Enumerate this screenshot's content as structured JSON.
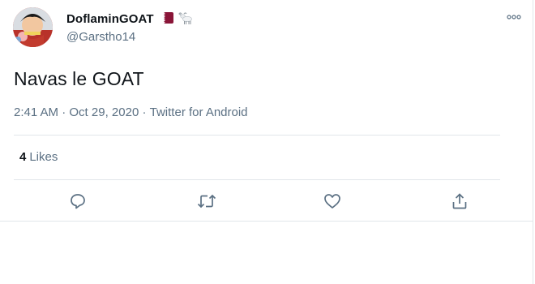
{
  "user": {
    "display_name": "DoflaminGOAT",
    "handle": "@Garstho14",
    "emoji": [
      "qatar-flag",
      "goat"
    ]
  },
  "tweet": {
    "text": "Navas le GOAT",
    "time": "2:41 AM",
    "separator1": " · ",
    "date": "Oct 29, 2020",
    "separator2": " · ",
    "source": "Twitter for Android"
  },
  "stats": {
    "likes_count": "4",
    "likes_label": "Likes"
  },
  "actions": [
    "reply-icon",
    "retweet-icon",
    "like-icon",
    "share-icon"
  ],
  "colors": {
    "text": "#0f1419",
    "secondary": "#5b7083",
    "divider": "#e1e6ea",
    "qatar_maroon": "#8a1538"
  }
}
